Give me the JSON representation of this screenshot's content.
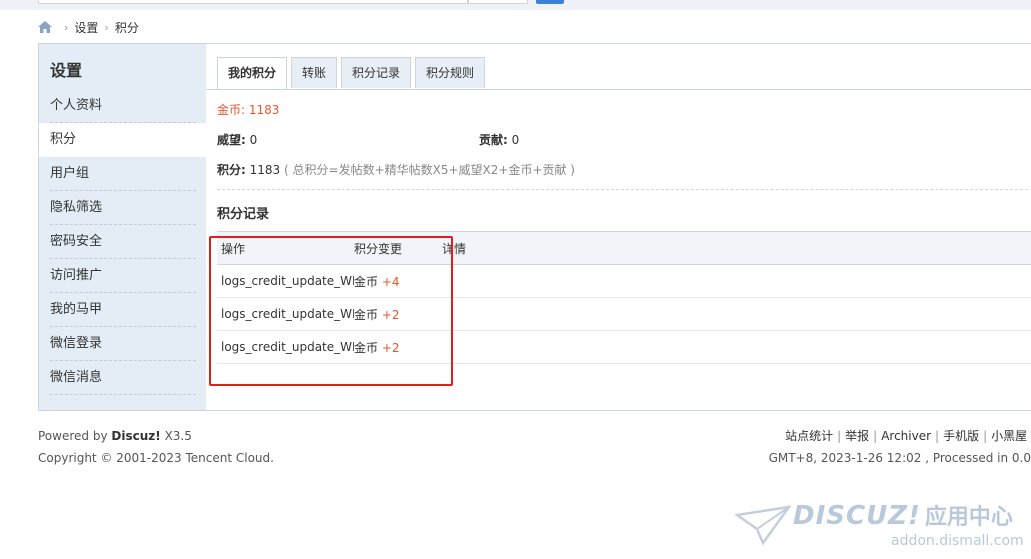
{
  "breadcrumb": {
    "items": [
      "设置",
      "积分"
    ],
    "home_icon": "home-icon"
  },
  "sidebar": {
    "title": "设置",
    "items": [
      {
        "label": "个人资料",
        "active": false
      },
      {
        "label": "积分",
        "active": true
      },
      {
        "label": "用户组",
        "active": false
      },
      {
        "label": "隐私筛选",
        "active": false
      },
      {
        "label": "密码安全",
        "active": false
      },
      {
        "label": "访问推广",
        "active": false
      },
      {
        "label": "我的马甲",
        "active": false
      },
      {
        "label": "微信登录",
        "active": false
      },
      {
        "label": "微信消息",
        "active": false
      }
    ]
  },
  "tabs": [
    "我的积分",
    "转账",
    "积分记录",
    "积分规则"
  ],
  "credits": {
    "gold_label": "金币:",
    "gold_value": "1183",
    "prestige_label": "威望:",
    "prestige_value": "0",
    "contribution_label": "贡献:",
    "contribution_value": "0",
    "total_label": "积分:",
    "total_value": "1183",
    "total_note": "( 总积分=发帖数+精华帖数X5+威望X2+金币+贡献 )"
  },
  "records": {
    "title": "积分记录",
    "columns": [
      "操作",
      "积分变更",
      "详情"
    ],
    "rows": [
      {
        "action": "logs_credit_update_WR",
        "unit": "金币",
        "change": "+4",
        "detail": ""
      },
      {
        "action": "logs_credit_update_WR",
        "unit": "金币",
        "change": "+2",
        "detail": ""
      },
      {
        "action": "logs_credit_update_WR",
        "unit": "金币",
        "change": "+2",
        "detail": ""
      }
    ]
  },
  "footer": {
    "powered_prefix": "Powered by",
    "powered_brand": "Discuz!",
    "powered_version": "X3.5",
    "copyright": "Copyright © 2001-2023 Tencent Cloud.",
    "links": [
      "站点统计",
      "举报",
      "Archiver",
      "手机版",
      "小黑屋"
    ],
    "time_info": "GMT+8, 2023-1-26 12:02 , Processed in 0.0"
  },
  "watermark": {
    "brand": "DISCUZ!",
    "brand_zh": "应用中心",
    "url": "addon.dismall.com"
  },
  "colors": {
    "accent_red": "#e4572e",
    "highlight_box": "#e11d1d",
    "sidebar_bg": "#e4ecf5"
  }
}
